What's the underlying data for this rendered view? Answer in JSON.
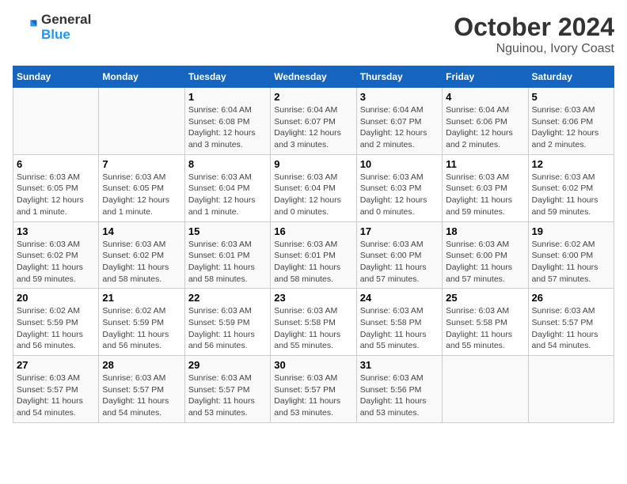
{
  "header": {
    "logo_line1": "General",
    "logo_line2": "Blue",
    "month": "October 2024",
    "location": "Nguinou, Ivory Coast"
  },
  "weekdays": [
    "Sunday",
    "Monday",
    "Tuesday",
    "Wednesday",
    "Thursday",
    "Friday",
    "Saturday"
  ],
  "weeks": [
    [
      {
        "day": "",
        "info": ""
      },
      {
        "day": "",
        "info": ""
      },
      {
        "day": "1",
        "info": "Sunrise: 6:04 AM\nSunset: 6:08 PM\nDaylight: 12 hours and 3 minutes."
      },
      {
        "day": "2",
        "info": "Sunrise: 6:04 AM\nSunset: 6:07 PM\nDaylight: 12 hours and 3 minutes."
      },
      {
        "day": "3",
        "info": "Sunrise: 6:04 AM\nSunset: 6:07 PM\nDaylight: 12 hours and 2 minutes."
      },
      {
        "day": "4",
        "info": "Sunrise: 6:04 AM\nSunset: 6:06 PM\nDaylight: 12 hours and 2 minutes."
      },
      {
        "day": "5",
        "info": "Sunrise: 6:03 AM\nSunset: 6:06 PM\nDaylight: 12 hours and 2 minutes."
      }
    ],
    [
      {
        "day": "6",
        "info": "Sunrise: 6:03 AM\nSunset: 6:05 PM\nDaylight: 12 hours and 1 minute."
      },
      {
        "day": "7",
        "info": "Sunrise: 6:03 AM\nSunset: 6:05 PM\nDaylight: 12 hours and 1 minute."
      },
      {
        "day": "8",
        "info": "Sunrise: 6:03 AM\nSunset: 6:04 PM\nDaylight: 12 hours and 1 minute."
      },
      {
        "day": "9",
        "info": "Sunrise: 6:03 AM\nSunset: 6:04 PM\nDaylight: 12 hours and 0 minutes."
      },
      {
        "day": "10",
        "info": "Sunrise: 6:03 AM\nSunset: 6:03 PM\nDaylight: 12 hours and 0 minutes."
      },
      {
        "day": "11",
        "info": "Sunrise: 6:03 AM\nSunset: 6:03 PM\nDaylight: 11 hours and 59 minutes."
      },
      {
        "day": "12",
        "info": "Sunrise: 6:03 AM\nSunset: 6:02 PM\nDaylight: 11 hours and 59 minutes."
      }
    ],
    [
      {
        "day": "13",
        "info": "Sunrise: 6:03 AM\nSunset: 6:02 PM\nDaylight: 11 hours and 59 minutes."
      },
      {
        "day": "14",
        "info": "Sunrise: 6:03 AM\nSunset: 6:02 PM\nDaylight: 11 hours and 58 minutes."
      },
      {
        "day": "15",
        "info": "Sunrise: 6:03 AM\nSunset: 6:01 PM\nDaylight: 11 hours and 58 minutes."
      },
      {
        "day": "16",
        "info": "Sunrise: 6:03 AM\nSunset: 6:01 PM\nDaylight: 11 hours and 58 minutes."
      },
      {
        "day": "17",
        "info": "Sunrise: 6:03 AM\nSunset: 6:00 PM\nDaylight: 11 hours and 57 minutes."
      },
      {
        "day": "18",
        "info": "Sunrise: 6:03 AM\nSunset: 6:00 PM\nDaylight: 11 hours and 57 minutes."
      },
      {
        "day": "19",
        "info": "Sunrise: 6:02 AM\nSunset: 6:00 PM\nDaylight: 11 hours and 57 minutes."
      }
    ],
    [
      {
        "day": "20",
        "info": "Sunrise: 6:02 AM\nSunset: 5:59 PM\nDaylight: 11 hours and 56 minutes."
      },
      {
        "day": "21",
        "info": "Sunrise: 6:02 AM\nSunset: 5:59 PM\nDaylight: 11 hours and 56 minutes."
      },
      {
        "day": "22",
        "info": "Sunrise: 6:03 AM\nSunset: 5:59 PM\nDaylight: 11 hours and 56 minutes."
      },
      {
        "day": "23",
        "info": "Sunrise: 6:03 AM\nSunset: 5:58 PM\nDaylight: 11 hours and 55 minutes."
      },
      {
        "day": "24",
        "info": "Sunrise: 6:03 AM\nSunset: 5:58 PM\nDaylight: 11 hours and 55 minutes."
      },
      {
        "day": "25",
        "info": "Sunrise: 6:03 AM\nSunset: 5:58 PM\nDaylight: 11 hours and 55 minutes."
      },
      {
        "day": "26",
        "info": "Sunrise: 6:03 AM\nSunset: 5:57 PM\nDaylight: 11 hours and 54 minutes."
      }
    ],
    [
      {
        "day": "27",
        "info": "Sunrise: 6:03 AM\nSunset: 5:57 PM\nDaylight: 11 hours and 54 minutes."
      },
      {
        "day": "28",
        "info": "Sunrise: 6:03 AM\nSunset: 5:57 PM\nDaylight: 11 hours and 54 minutes."
      },
      {
        "day": "29",
        "info": "Sunrise: 6:03 AM\nSunset: 5:57 PM\nDaylight: 11 hours and 53 minutes."
      },
      {
        "day": "30",
        "info": "Sunrise: 6:03 AM\nSunset: 5:57 PM\nDaylight: 11 hours and 53 minutes."
      },
      {
        "day": "31",
        "info": "Sunrise: 6:03 AM\nSunset: 5:56 PM\nDaylight: 11 hours and 53 minutes."
      },
      {
        "day": "",
        "info": ""
      },
      {
        "day": "",
        "info": ""
      }
    ]
  ]
}
